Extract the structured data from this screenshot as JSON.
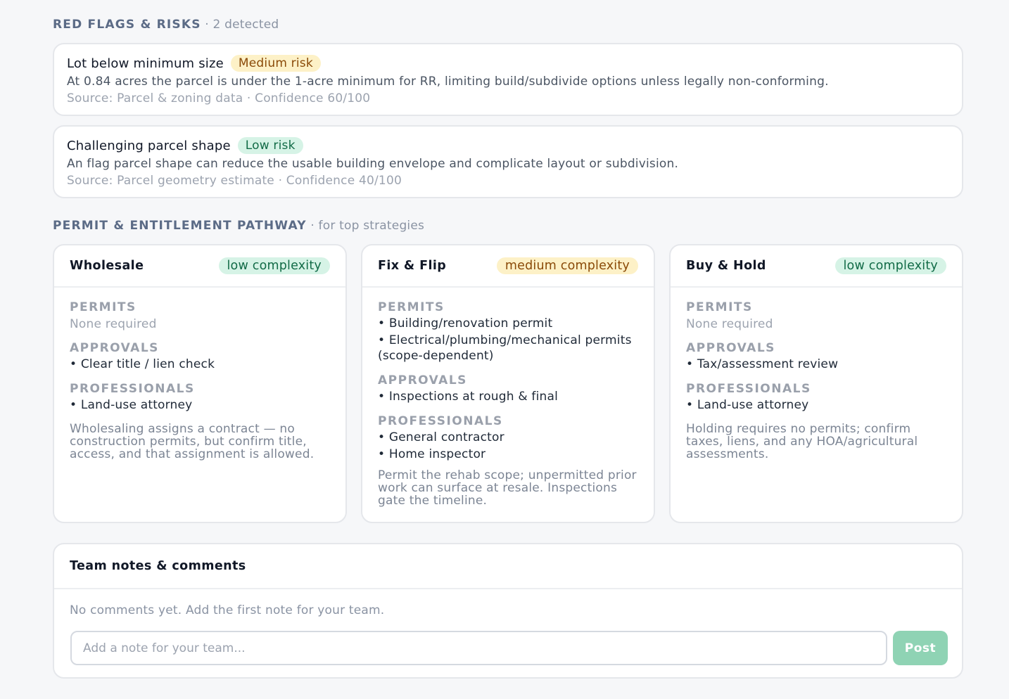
{
  "red_flags": {
    "title": "RED FLAGS & RISKS",
    "subtitle": "· 2 detected",
    "items": [
      {
        "title": "Lot below minimum size",
        "risk": "Medium risk",
        "description": "At 0.84 acres the parcel is under the 1-acre minimum for RR, limiting build/subdivide options unless legally non-conforming.",
        "source": "Source: Parcel & zoning data · Confidence 60/100"
      },
      {
        "title": "Challenging parcel shape",
        "risk": "Low risk",
        "description": "An flag parcel shape can reduce the usable building envelope and complicate layout or subdivision.",
        "source": "Source: Parcel geometry estimate · Confidence 40/100"
      }
    ]
  },
  "permits": {
    "title": "PERMIT & ENTITLEMENT PATHWAY",
    "subtitle": "· for top strategies",
    "labels": {
      "permits": "PERMITS",
      "approvals": "APPROVALS",
      "professionals": "PROFESSIONALS"
    },
    "strategies": [
      {
        "name": "Wholesale",
        "complexity": "low complexity",
        "permits_none": "None required",
        "approvals": [
          "• Clear title / lien check"
        ],
        "professionals": [
          "• Land-use attorney"
        ],
        "note": "Wholesaling assigns a contract — no construction permits, but confirm title, access, and that assignment is allowed."
      },
      {
        "name": "Fix & Flip",
        "complexity": "medium complexity",
        "permits": [
          "• Building/renovation permit",
          "• Electrical/plumbing/mechanical permits (scope-dependent)"
        ],
        "approvals": [
          "• Inspections at rough & final"
        ],
        "professionals": [
          "• General contractor",
          "• Home inspector"
        ],
        "note": "Permit the rehab scope; unpermitted prior work can surface at resale. Inspections gate the timeline."
      },
      {
        "name": "Buy & Hold",
        "complexity": "low complexity",
        "permits_none": "None required",
        "approvals": [
          "• Tax/assessment review"
        ],
        "professionals": [
          "• Land-use attorney"
        ],
        "note": "Holding requires no permits; confirm taxes, liens, and any HOA/agricultural assessments."
      }
    ]
  },
  "team_notes": {
    "title": "Team notes & comments",
    "empty": "No comments yet. Add the first note for your team.",
    "placeholder": "Add a note for your team...",
    "value": "",
    "post_label": "Post"
  }
}
